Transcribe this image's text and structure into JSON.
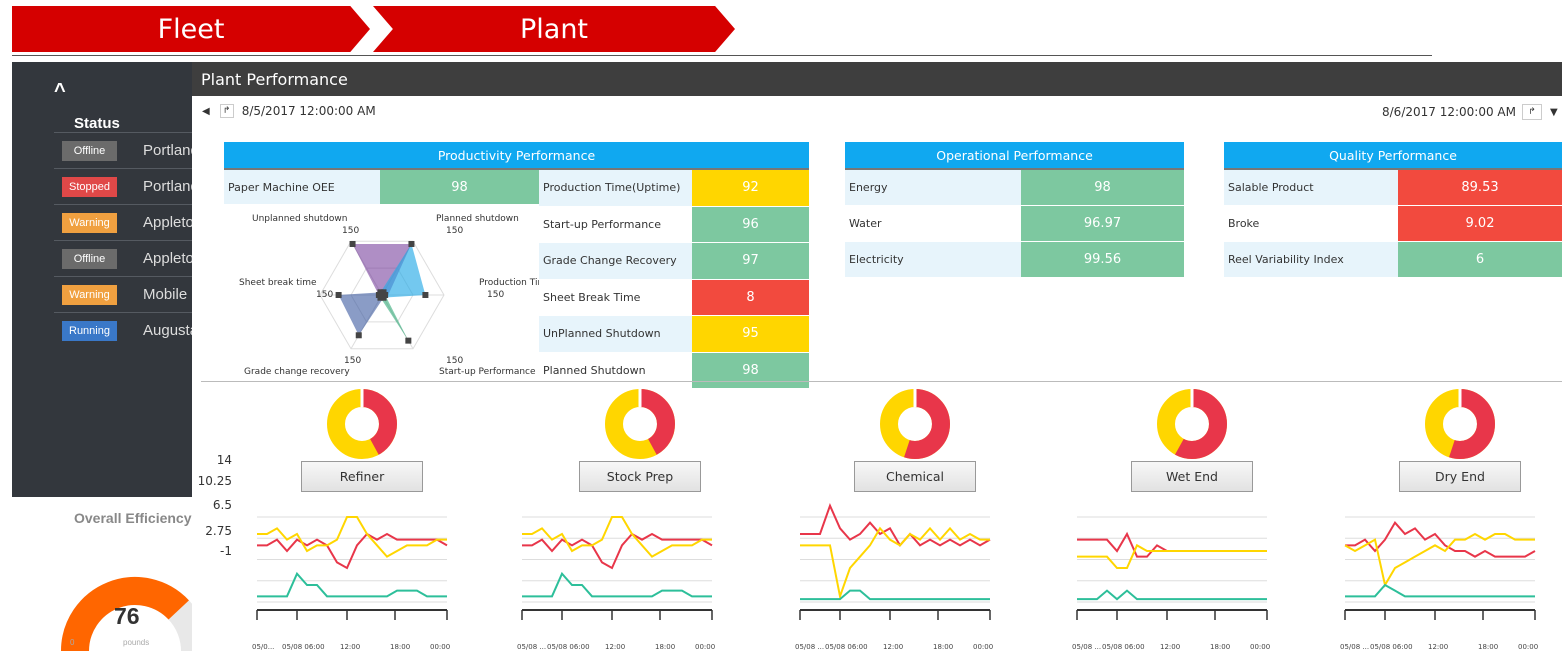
{
  "breadcrumb": {
    "fleet": "Fleet",
    "plant": "Plant"
  },
  "sidebar": {
    "status_heading": "Status",
    "rows": [
      {
        "status": "Offline",
        "color": "#6b6b6b",
        "site": "Portland"
      },
      {
        "status": "Stopped",
        "color": "#e04848",
        "site": "Portland"
      },
      {
        "status": "Warning",
        "color": "#f0a040",
        "site": "Appleton"
      },
      {
        "status": "Offline",
        "color": "#6b6b6b",
        "site": "Appleton"
      },
      {
        "status": "Warning",
        "color": "#f0a040",
        "site": "Mobile"
      },
      {
        "status": "Running",
        "color": "#3a78c8",
        "site": "Augusta"
      }
    ],
    "overall_label": "Overall Efficiency",
    "gauge": {
      "value": "76",
      "min": "0",
      "unit": "pounds",
      "fraction": 0.76
    }
  },
  "main": {
    "title": "Plant Performance",
    "start_time": "8/5/2017 12:00:00 AM",
    "end_time": "8/6/2017 12:00:00 AM"
  },
  "productivity": {
    "title": "Productivity Performance",
    "oee_label": "Paper Machine OEE",
    "oee_value": "98",
    "rows": [
      {
        "label": "Production Time(Uptime)",
        "value": "92",
        "color": "#ffd600"
      },
      {
        "label": "Start-up Performance",
        "value": "96",
        "color": "#7dc8a0"
      },
      {
        "label": "Grade Change Recovery",
        "value": "97",
        "color": "#7dc8a0"
      },
      {
        "label": "Sheet Break Time",
        "value": "8",
        "color": "#f24a3e"
      },
      {
        "label": "UnPlanned Shutdown",
        "value": "95",
        "color": "#ffd600"
      },
      {
        "label": "Planned Shutdown",
        "value": "98",
        "color": "#7dc8a0"
      }
    ],
    "radar": {
      "axes": [
        {
          "name": "Planned shutdown",
          "max": "150"
        },
        {
          "name": "Production Time",
          "max": "150"
        },
        {
          "name": "Start-up Performance",
          "max": "150"
        },
        {
          "name": "Grade change recovery",
          "max": "150"
        },
        {
          "name": "Sheet break time",
          "max": "150"
        },
        {
          "name": "Unplanned shutdown",
          "max": "150"
        }
      ]
    }
  },
  "operational": {
    "title": "Operational Performance",
    "rows": [
      {
        "label": "Energy",
        "value": "98",
        "color": "#7dc8a0"
      },
      {
        "label": "Water",
        "value": "96.97",
        "color": "#7dc8a0"
      },
      {
        "label": "Electricity",
        "value": "99.56",
        "color": "#7dc8a0"
      }
    ]
  },
  "quality": {
    "title": "Quality Performance",
    "rows": [
      {
        "label": "Salable Product",
        "value": "89.53",
        "color": "#f24a3e"
      },
      {
        "label": "Broke",
        "value": "9.02",
        "color": "#f24a3e"
      },
      {
        "label": "Reel Variability Index",
        "value": "6",
        "color": "#7dc8a0"
      }
    ]
  },
  "areas": [
    {
      "label": "Refiner",
      "red_fraction": 0.42
    },
    {
      "label": "Stock Prep",
      "red_fraction": 0.42
    },
    {
      "label": "Chemical",
      "red_fraction": 0.55
    },
    {
      "label": "Wet End",
      "red_fraction": 0.58
    },
    {
      "label": "Dry End",
      "red_fraction": 0.55
    }
  ],
  "colors": {
    "red": "#e8364a",
    "yellow": "#ffd600",
    "green": "#2dbf9a"
  },
  "chart_data": [
    {
      "type": "line",
      "title": "Refiner",
      "y_ticks": [
        "14",
        "10.25",
        "6.5",
        "2.75",
        "-1"
      ],
      "ylim": [
        -1,
        14
      ],
      "x_ticks": [
        "05/0...",
        "05/08 06:00",
        "12:00",
        "18:00",
        "00:00"
      ],
      "series": [
        {
          "color": "#e8364a",
          "values": [
            9,
            9,
            10,
            8,
            10,
            9,
            10,
            9,
            6,
            5,
            9,
            11,
            10,
            11,
            10,
            10,
            10,
            10,
            10,
            9
          ]
        },
        {
          "color": "#ffd600",
          "values": [
            11,
            11,
            12,
            10,
            11,
            8,
            9,
            9,
            10,
            14,
            14,
            11,
            9,
            7,
            8,
            9,
            9,
            9,
            10,
            10
          ]
        },
        {
          "color": "#2dbf9a",
          "values": [
            0,
            0,
            0,
            0,
            4,
            2,
            2,
            0,
            0,
            0,
            0,
            0,
            0,
            0,
            1,
            1,
            1,
            0,
            0,
            0
          ]
        }
      ]
    },
    {
      "type": "line",
      "title": "Stock Prep",
      "x_ticks": [
        "05/08 ...",
        "05/08 06:00",
        "12:00",
        "18:00",
        "00:00"
      ],
      "ylim": [
        -1,
        14
      ],
      "series": [
        {
          "color": "#e8364a",
          "values": [
            9,
            9,
            10,
            8,
            10,
            9,
            10,
            9,
            6,
            5,
            9,
            11,
            10,
            11,
            10,
            10,
            10,
            10,
            10,
            9
          ]
        },
        {
          "color": "#ffd600",
          "values": [
            11,
            11,
            12,
            10,
            11,
            8,
            9,
            9,
            10,
            14,
            14,
            11,
            9,
            7,
            8,
            9,
            9,
            9,
            10,
            10
          ]
        },
        {
          "color": "#2dbf9a",
          "values": [
            0,
            0,
            0,
            0,
            4,
            2,
            2,
            0,
            0,
            0,
            0,
            0,
            0,
            0,
            1,
            1,
            1,
            0,
            0,
            0
          ]
        }
      ]
    },
    {
      "type": "line",
      "title": "Chemical",
      "x_ticks": [
        "05/08 ...",
        "05/08 06:00",
        "12:00",
        "18:00",
        "00:00"
      ],
      "ylim": [
        -1,
        14
      ],
      "series": [
        {
          "color": "#e8364a",
          "values": [
            11,
            11,
            11,
            16,
            12,
            10,
            11,
            13,
            11,
            12,
            9,
            11,
            9,
            10,
            9,
            10,
            9,
            10,
            9,
            10
          ]
        },
        {
          "color": "#ffd600",
          "values": [
            9,
            9,
            9,
            9,
            0,
            5,
            7,
            9,
            12,
            10,
            9,
            11,
            10,
            12,
            10,
            12,
            10,
            11,
            10,
            10
          ]
        },
        {
          "color": "#2dbf9a",
          "values": [
            -0.5,
            -0.5,
            -0.5,
            -0.5,
            -0.5,
            1,
            1,
            -0.5,
            -0.5,
            -0.5,
            -0.5,
            -0.5,
            -0.5,
            -0.5,
            -0.5,
            -0.5,
            -0.5,
            -0.5,
            -0.5,
            -0.5
          ]
        }
      ]
    },
    {
      "type": "line",
      "title": "Wet End",
      "x_ticks": [
        "05/08 ...",
        "05/08 06:00",
        "12:00",
        "18:00",
        "00:00"
      ],
      "ylim": [
        -1,
        14
      ],
      "series": [
        {
          "color": "#e8364a",
          "values": [
            10,
            10,
            10,
            10,
            8,
            11,
            7,
            7,
            9,
            8,
            8,
            8,
            8,
            8,
            8,
            8,
            8,
            8,
            8,
            8
          ]
        },
        {
          "color": "#ffd600",
          "values": [
            7,
            7,
            7,
            7,
            5,
            5,
            9,
            8,
            8,
            8,
            8,
            8,
            8,
            8,
            8,
            8,
            8,
            8,
            8,
            8
          ]
        },
        {
          "color": "#2dbf9a",
          "values": [
            -0.5,
            -0.5,
            -0.5,
            1,
            -0.5,
            1,
            -0.5,
            -0.5,
            -0.5,
            -0.5,
            -0.5,
            -0.5,
            -0.5,
            -0.5,
            -0.5,
            -0.5,
            -0.5,
            -0.5,
            -0.5,
            -0.5
          ]
        }
      ]
    },
    {
      "type": "line",
      "title": "Dry End",
      "x_ticks": [
        "05/08 ...",
        "05/08 06:00",
        "12:00",
        "18:00",
        "00:00"
      ],
      "ylim": [
        -1,
        14
      ],
      "series": [
        {
          "color": "#e8364a",
          "values": [
            9,
            9,
            10,
            8,
            10,
            13,
            11,
            12,
            10,
            11,
            9,
            8,
            8,
            7,
            8,
            7,
            7,
            7,
            7,
            8
          ]
        },
        {
          "color": "#ffd600",
          "values": [
            9,
            8,
            9,
            10,
            2,
            5,
            6,
            7,
            8,
            9,
            8,
            10,
            10,
            11,
            10,
            11,
            11,
            10,
            10,
            10
          ]
        },
        {
          "color": "#2dbf9a",
          "values": [
            0,
            0,
            0,
            0,
            2,
            1,
            0,
            0,
            0,
            0,
            0,
            0,
            0,
            0,
            0,
            0,
            0,
            0,
            0,
            0
          ]
        }
      ]
    }
  ]
}
